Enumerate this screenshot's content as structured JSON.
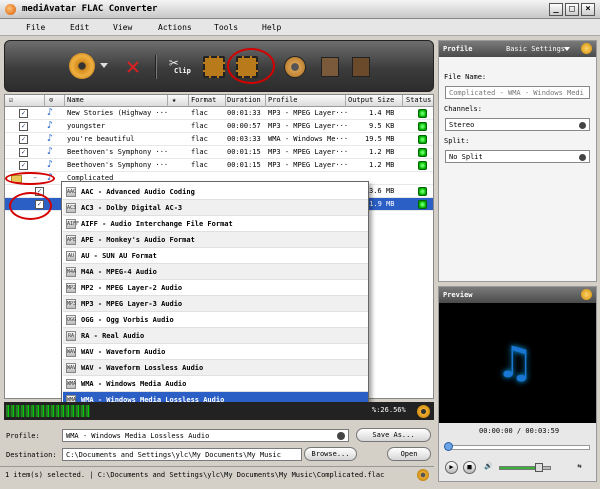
{
  "window": {
    "title": "mediAvatar FLAC Converter",
    "min": "_",
    "max": "□",
    "close": "×"
  },
  "menu": [
    "File",
    "Edit",
    "View",
    "Actions",
    "Tools",
    "Help"
  ],
  "toolbar": {
    "clip_label": "Clip"
  },
  "columns": [
    "Name",
    "★",
    "Format",
    "Duration",
    "Profile",
    "Output Size",
    "Status"
  ],
  "rows": [
    {
      "name": "New Stories (Highway ···",
      "format": "flac",
      "duration": "00:01:33",
      "profile": "MP3 - MPEG Layer···",
      "size": "1.4 MB"
    },
    {
      "name": "youngster",
      "format": "flac",
      "duration": "00:00:57",
      "profile": "MP3 - MPEG Layer···",
      "size": "9.5 KB"
    },
    {
      "name": "you're beautiful",
      "format": "flac",
      "duration": "00:03:33",
      "profile": "WMA - Windows Me···",
      "size": "19.5 MB"
    },
    {
      "name": "Beethoven's Symphony ···",
      "format": "flac",
      "duration": "00:01:15",
      "profile": "MP3 - MPEG Layer···",
      "size": "1.2 MB"
    },
    {
      "name": "Beethoven's Symphony ···",
      "format": "flac",
      "duration": "00:01:15",
      "profile": "MP3 - MPEG Layer···",
      "size": "1.2 MB"
    }
  ],
  "group": {
    "name": "Complicated"
  },
  "group_rows": [
    {
      "size": "3.6 MB"
    },
    {
      "size": "21.9 MB"
    }
  ],
  "profile_options": [
    {
      "code": "AAC",
      "label": "AAC - Advanced Audio Coding"
    },
    {
      "code": "AC3",
      "label": "AC3 - Dolby Digital AC-3"
    },
    {
      "code": "AIFF",
      "label": "AIFF - Audio Interchange File Format"
    },
    {
      "code": "APE",
      "label": "APE - Monkey's Audio Format"
    },
    {
      "code": "AU",
      "label": "AU - SUN AU Format"
    },
    {
      "code": "M4A",
      "label": "M4A - MPEG-4 Audio"
    },
    {
      "code": "MP2",
      "label": "MP2 - MPEG Layer-2 Audio"
    },
    {
      "code": "MP3",
      "label": "MP3 - MPEG Layer-3 Audio"
    },
    {
      "code": "OGG",
      "label": "OGG - Ogg Vorbis Audio"
    },
    {
      "code": "RA",
      "label": "RA - Real Audio"
    },
    {
      "code": "WAV",
      "label": "WAV - Waveform Audio"
    },
    {
      "code": "WAV",
      "label": "WAV - Waveform Lossless Audio"
    },
    {
      "code": "WMA",
      "label": "WMA - Windows Media Audio"
    },
    {
      "code": "WMA",
      "label": "WMA - Windows Media Lossless Audio"
    }
  ],
  "progress_text": "%:26.56%",
  "bottom": {
    "profile_label": "Profile:",
    "profile_value": "WMA - Windows Media Lossless Audio",
    "save_as": "Save As...",
    "destination_label": "Destination:",
    "destination_value": "C:\\Documents and Settings\\ylc\\My Documents\\My Music",
    "browse": "Browse...",
    "open": "Open"
  },
  "status_text": "1 item(s) selected. | C:\\Documents and Settings\\ylc\\My Documents\\My Music\\Complicated.flac",
  "profile_panel": {
    "title": "Profile",
    "settings": "Basic Settings",
    "file_name_label": "File Name:",
    "file_name_value": "Complicated - WMA - Windows Medi",
    "channels_label": "Channels:",
    "channels_value": "Stereo",
    "split_label": "Split:",
    "split_value": "No Split"
  },
  "preview": {
    "title": "Preview",
    "time": "00:00:00 / 00:03:59"
  },
  "colors": {
    "accent": "#2b5fc6",
    "highlight_ring": "#d40000",
    "status_green": "#00aa00"
  }
}
